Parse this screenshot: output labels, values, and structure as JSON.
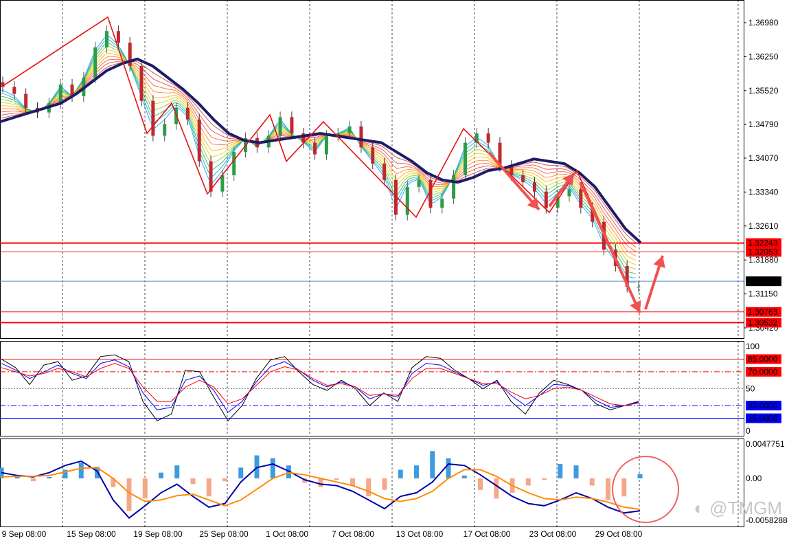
{
  "chart_data": [
    {
      "type": "line",
      "panel": "price",
      "title": "",
      "xlabel": "",
      "ylabel": "",
      "ylim": [
        1.3036,
        1.3738
      ],
      "x_tick_labels": [
        "9 Sep 08:00",
        "15 Sep 08:00",
        "19 Sep 08:00",
        "25 Sep 08:00",
        "1 Oct 08:00",
        "7 Oct 08:00",
        "13 Oct 08:00",
        "17 Oct 08:00",
        "23 Oct 08:00",
        "29 Oct 08:00"
      ],
      "y_ticks": [
        1.3698,
        1.3625,
        1.3552,
        1.3479,
        1.3407,
        1.3334,
        1.3261,
        1.3188,
        1.3115,
        1.3042
      ],
      "y_tick_labels": [
        "1.36980",
        "1.36250",
        "1.35520",
        "1.34790",
        "1.34070",
        "1.33340",
        "1.32610",
        "1.31880",
        "1.31150",
        "1.30420"
      ],
      "close_series": [
        1.356,
        1.3545,
        1.3515,
        1.3505,
        1.3525,
        1.3565,
        1.354,
        1.358,
        1.3645,
        1.368,
        1.3655,
        1.3605,
        1.353,
        1.3455,
        1.348,
        1.3515,
        1.349,
        1.34,
        1.3335,
        1.337,
        1.342,
        1.345,
        1.343,
        1.3455,
        1.3495,
        1.346,
        1.344,
        1.3415,
        1.3455,
        1.346,
        1.3475,
        1.343,
        1.3395,
        1.336,
        1.3285,
        1.3345,
        1.336,
        1.33,
        1.332,
        1.337,
        1.344,
        1.346,
        1.344,
        1.339,
        1.337,
        1.3355,
        1.3335,
        1.33,
        1.3325,
        1.334,
        1.33,
        1.327,
        1.321,
        1.3175,
        1.313,
        1.313
      ],
      "ema_series": [
        1.3485,
        1.3495,
        1.3505,
        1.3515,
        1.3525,
        1.3545,
        1.357,
        1.3595,
        1.361,
        1.362,
        1.3605,
        1.358,
        1.3555,
        1.3525,
        1.349,
        1.346,
        1.3445,
        1.344,
        1.3445,
        1.345,
        1.3455,
        1.346,
        1.3455,
        1.345,
        1.3445,
        1.344,
        1.342,
        1.34,
        1.3375,
        1.336,
        1.3355,
        1.3365,
        1.338,
        1.3385,
        1.3395,
        1.3405,
        1.34,
        1.3395,
        1.3375,
        1.3345,
        1.33,
        1.3255,
        1.3225
      ],
      "zigzag": [
        1.356,
        1.371,
        1.346,
        1.3525,
        1.333,
        1.35,
        1.34,
        1.3485,
        1.328,
        1.347,
        1.329,
        1.338,
        1.3075
      ],
      "horizontal_lines": [
        {
          "value": 1.32243,
          "label": "1.32243",
          "color": "#ff0000"
        },
        {
          "value": 1.32053,
          "label": "1.32053",
          "color": "#ff0000"
        },
        {
          "value": 1.31422,
          "label": "1.31422",
          "color": "#000000"
        },
        {
          "value": 1.30763,
          "label": "1.30763",
          "color": "#ff0000"
        },
        {
          "value": 1.30532,
          "label": "1.30532",
          "color": "#ff0000"
        }
      ],
      "grid": true
    },
    {
      "type": "line",
      "panel": "stochastic",
      "ylim": [
        0,
        100
      ],
      "y_tick_labels": [
        "100",
        "50",
        "0"
      ],
      "levels": [
        {
          "value": 85,
          "label": "85.0000",
          "color": "#ff0000"
        },
        {
          "value": 70,
          "label": "70.0000",
          "color": "#ff0000"
        },
        {
          "value": 30,
          "label": "30.0000",
          "color": "#0000ff"
        },
        {
          "value": 15,
          "label": "15.0000",
          "color": "#0000ff"
        }
      ],
      "series": [
        {
          "color": "#000000",
          "values": [
            85,
            75,
            55,
            78,
            82,
            60,
            65,
            88,
            90,
            82,
            35,
            12,
            20,
            72,
            70,
            40,
            12,
            30,
            62,
            84,
            88,
            70,
            55,
            48,
            60,
            50,
            30,
            45,
            35,
            75,
            88,
            86,
            72,
            62,
            50,
            60,
            35,
            20,
            45,
            60,
            55,
            48,
            32,
            25,
            30,
            35
          ]
        },
        {
          "color": "#0000ff",
          "values": [
            80,
            72,
            62,
            70,
            78,
            68,
            62,
            80,
            84,
            76,
            45,
            25,
            28,
            60,
            65,
            48,
            22,
            35,
            58,
            76,
            82,
            72,
            60,
            52,
            58,
            52,
            38,
            44,
            40,
            68,
            80,
            78,
            70,
            62,
            54,
            58,
            42,
            30,
            42,
            55,
            54,
            48,
            36,
            28,
            30,
            34
          ]
        },
        {
          "color": "#ff0000",
          "values": [
            75,
            70,
            65,
            68,
            74,
            70,
            64,
            74,
            80,
            74,
            52,
            35,
            35,
            52,
            60,
            52,
            32,
            38,
            54,
            70,
            76,
            72,
            62,
            54,
            56,
            52,
            42,
            44,
            42,
            62,
            74,
            74,
            68,
            62,
            56,
            56,
            46,
            38,
            42,
            50,
            52,
            48,
            40,
            32,
            30,
            33
          ]
        }
      ]
    },
    {
      "type": "bar",
      "panel": "macd",
      "ylim": [
        -0.0058288,
        0.0047751
      ],
      "y_tick_labels": [
        "0.0047751",
        "0.00",
        "-0.0058288"
      ],
      "histogram": [
        0.0015,
        0.0004,
        -0.0004,
        0.0002,
        0.0012,
        0.0022,
        0.0016,
        -0.0012,
        -0.0045,
        -0.0028,
        0.0008,
        0.0018,
        -0.0008,
        -0.0025,
        -0.0004,
        0.0015,
        0.0032,
        0.0028,
        0.0018,
        -0.0006,
        -0.0012,
        -0.0002,
        -0.001,
        -0.0025,
        -0.0016,
        0.0012,
        0.0018,
        0.0038,
        0.0028,
        0.0004,
        -0.0016,
        -0.0028,
        -0.002,
        -0.001,
        -0.0002,
        0.002,
        0.0018,
        -0.001,
        -0.003,
        -0.0025,
        0.0006
      ],
      "series": [
        {
          "color": "#0000aa",
          "values": [
            0.0008,
            0.0004,
            0.0002,
            0.0008,
            0.0018,
            0.0024,
            0.001,
            -0.003,
            -0.0055,
            -0.0038,
            -0.002,
            -0.0008,
            -0.0025,
            -0.004,
            -0.0035,
            -0.0005,
            0.0015,
            0.002,
            0.001,
            -0.0002,
            -0.0008,
            -0.001,
            -0.0018,
            -0.003,
            -0.0042,
            -0.0025,
            -0.002,
            -0.0005,
            0.002,
            0.0018,
            0.0005,
            -0.001,
            -0.0025,
            -0.0035,
            -0.0038,
            -0.003,
            -0.002,
            -0.0028,
            -0.004,
            -0.0048,
            -0.0045
          ]
        },
        {
          "color": "#ff8c00",
          "values": [
            0.0002,
            0.0003,
            0.0003,
            0.0004,
            0.0009,
            0.0014,
            0.0015,
            0.0,
            -0.002,
            -0.0032,
            -0.003,
            -0.0024,
            -0.0022,
            -0.003,
            -0.0038,
            -0.003,
            -0.0015,
            0.0,
            0.0008,
            0.0005,
            0.0,
            -0.0005,
            -0.001,
            -0.0018,
            -0.0028,
            -0.0032,
            -0.0028,
            -0.0018,
            0.0,
            0.0012,
            0.0012,
            0.0003,
            -0.001,
            -0.002,
            -0.0028,
            -0.003,
            -0.0026,
            -0.0028,
            -0.0033,
            -0.004,
            -0.0043
          ]
        }
      ],
      "colors": {
        "positive": "#3d9be0",
        "negative": "#f4a888"
      }
    }
  ],
  "colors": {
    "grid": "#000000",
    "background": "#ffffff",
    "ema_line": "#1c1c6a",
    "zigzag": "#e81010",
    "arrow": "#f05050",
    "circle": "#f06060"
  },
  "watermark": "@TMGM"
}
